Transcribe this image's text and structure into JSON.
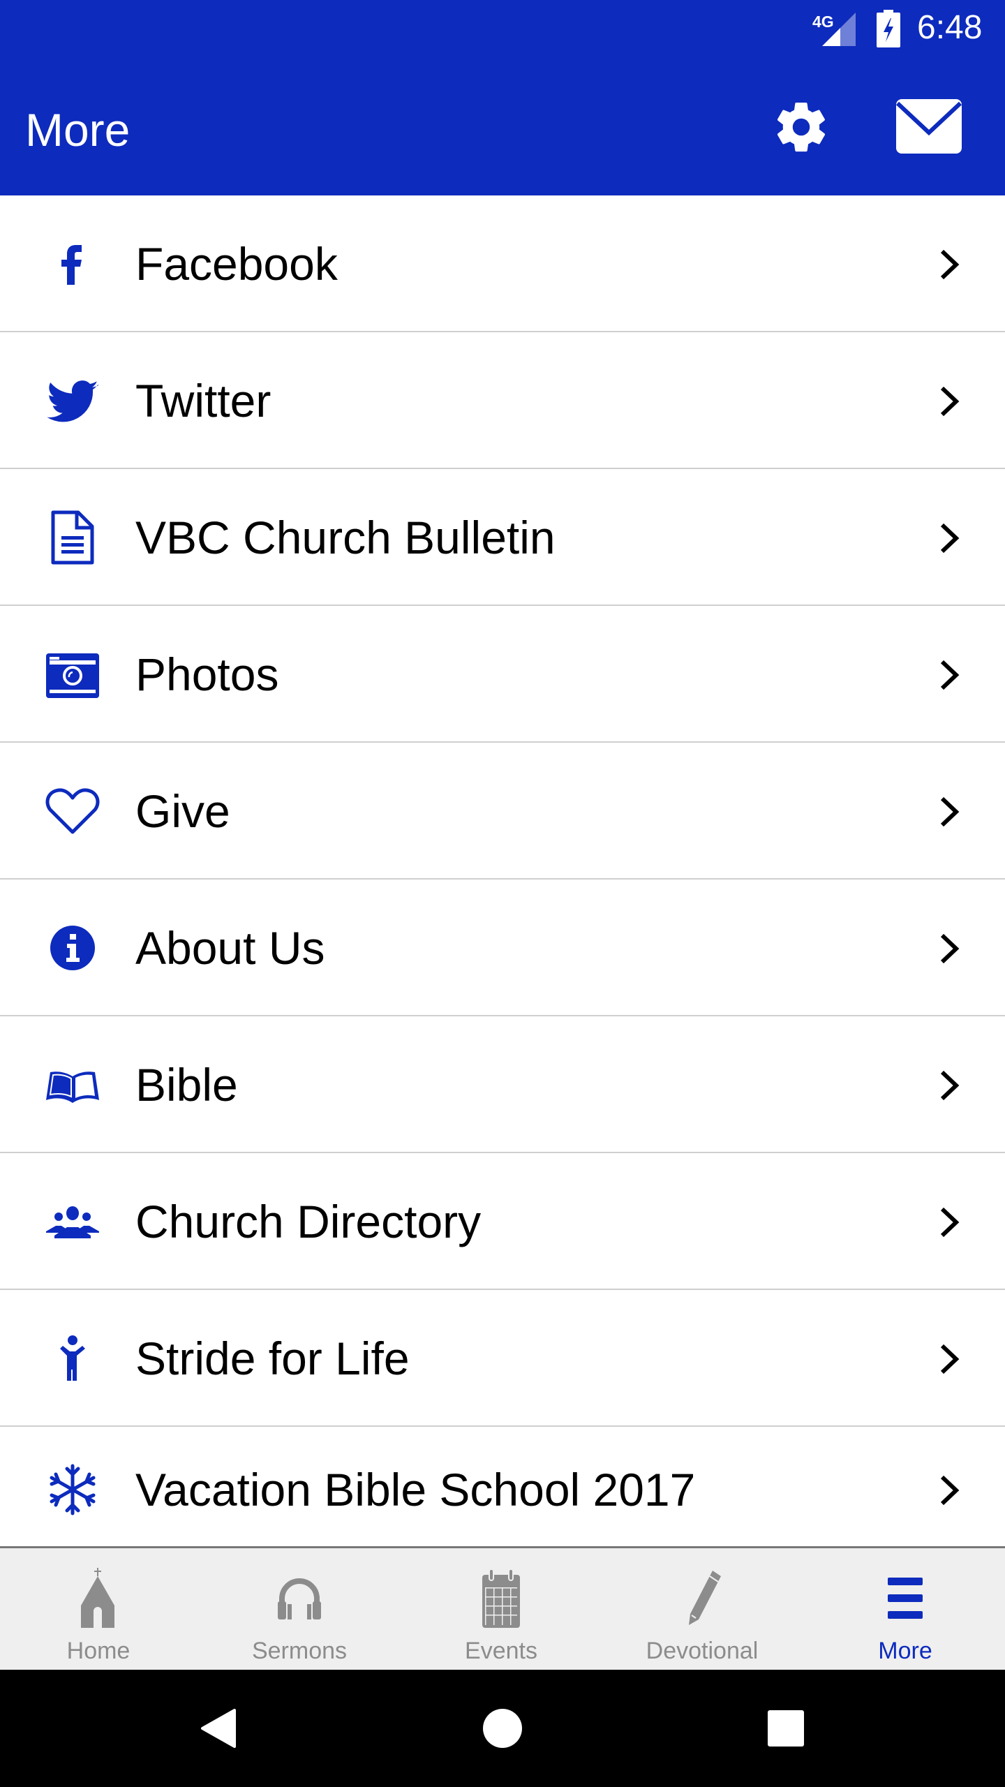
{
  "status_bar": {
    "network": "4G",
    "time": "6:48"
  },
  "app_bar": {
    "title": "More",
    "settings_icon": "gear-icon",
    "messages_icon": "mail-icon"
  },
  "colors": {
    "brand": "#0d2bbd",
    "tab_inactive": "#8c8c8c",
    "tab_bg": "#efefef",
    "divider": "#cfcfcf"
  },
  "menu": {
    "items": [
      {
        "label": "Facebook",
        "icon": "facebook-icon"
      },
      {
        "label": "Twitter",
        "icon": "twitter-icon"
      },
      {
        "label": "VBC Church Bulletin",
        "icon": "document-icon"
      },
      {
        "label": "Photos",
        "icon": "camera-icon"
      },
      {
        "label": "Give",
        "icon": "heart-icon"
      },
      {
        "label": "About Us",
        "icon": "info-icon"
      },
      {
        "label": "Bible",
        "icon": "book-icon"
      },
      {
        "label": "Church Directory",
        "icon": "group-icon"
      },
      {
        "label": "Stride for Life",
        "icon": "child-icon"
      },
      {
        "label": "Vacation Bible School 2017",
        "icon": "snowflake-icon"
      }
    ]
  },
  "tabs": [
    {
      "label": "Home",
      "icon": "church-icon",
      "active": false
    },
    {
      "label": "Sermons",
      "icon": "headphones-icon",
      "active": false
    },
    {
      "label": "Events",
      "icon": "calendar-icon",
      "active": false
    },
    {
      "label": "Devotional",
      "icon": "pencil-icon",
      "active": false
    },
    {
      "label": "More",
      "icon": "menu-icon",
      "active": true
    }
  ],
  "nav_bar": {
    "back": "back-icon",
    "home": "home-circle-icon",
    "recents": "recents-icon"
  }
}
